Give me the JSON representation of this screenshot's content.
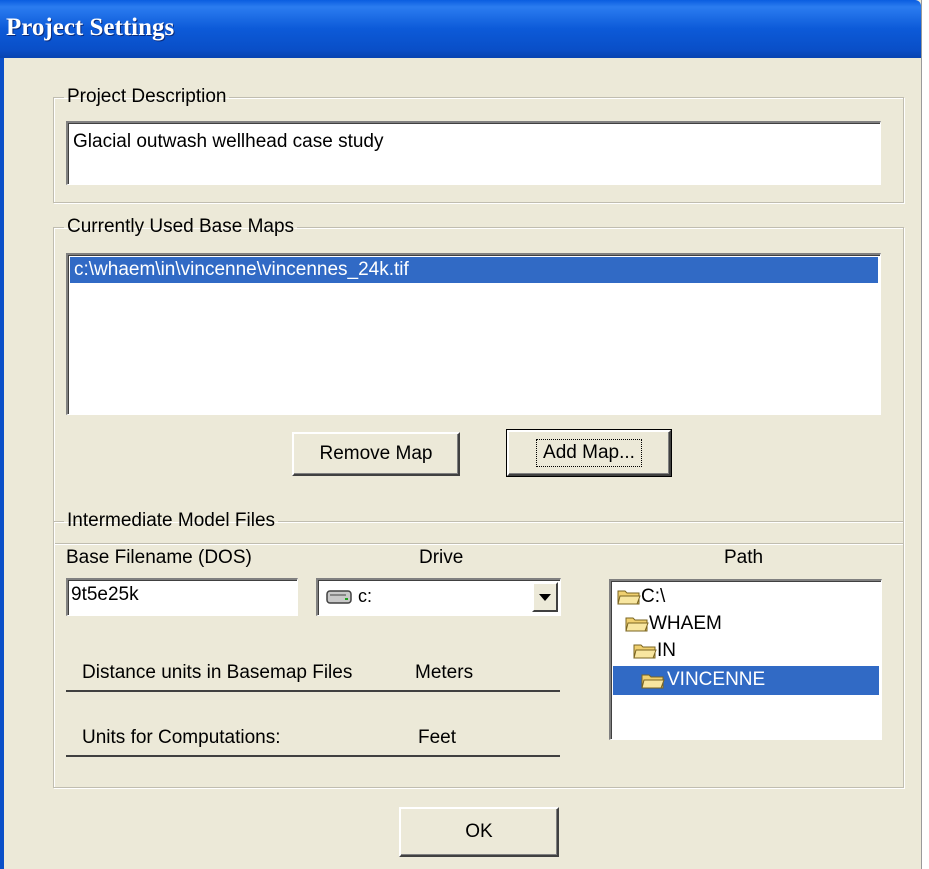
{
  "window": {
    "title": "Project Settings"
  },
  "project_description": {
    "legend": "Project Description",
    "value": "Glacial outwash wellhead case study"
  },
  "base_maps": {
    "legend": "Currently Used Base Maps",
    "items": [
      "c:\\whaem\\in\\vincenne\\vincennes_24k.tif"
    ],
    "selected_index": 0,
    "remove_button": "Remove Map",
    "add_button": "Add Map..."
  },
  "model_files": {
    "legend": "Intermediate Model Files",
    "base_filename_label": "Base Filename  (DOS)",
    "base_filename_value": "9t5e25k",
    "drive_label": "Drive",
    "drive_value": "c:",
    "path_label": "Path",
    "path_items": [
      "C:\\",
      "WHAEM",
      "IN",
      "VINCENNE"
    ],
    "path_selected_index": 3,
    "distance_units_label": "Distance units in Basemap Files",
    "distance_units_value": "Meters",
    "computation_units_label": "Units for Computations:",
    "computation_units_value": "Feet"
  },
  "ok_button": "OK",
  "colors": {
    "titlebar": "#0a5de0",
    "dialog_bg": "#ece9d8",
    "selection": "#316ac5"
  },
  "icons": {
    "drive": "drive-icon",
    "folder": "folder-open-icon",
    "dropdown": "chevron-down-icon"
  }
}
